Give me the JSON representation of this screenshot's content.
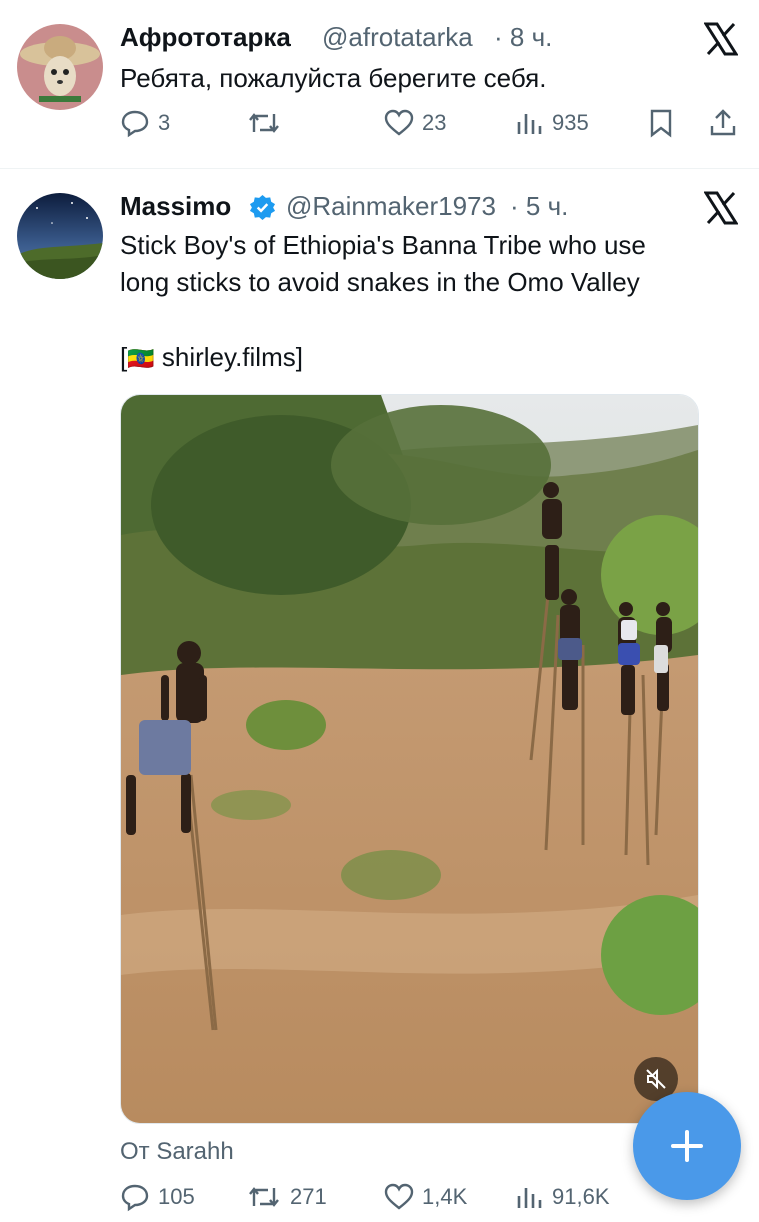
{
  "tweets": [
    {
      "author": "Афрототарка",
      "handle": "@afrotatarka",
      "time": "· 8 ч.",
      "text": "Ребята, пожалуйста берегите себя.",
      "stats": {
        "replies": "3",
        "retweets": "",
        "likes": "23",
        "views": "935"
      }
    },
    {
      "author": "Massimo",
      "handle": "@Rainmaker1973",
      "time": "· 5 ч.",
      "text_line1": "Stick Boy's of Ethiopia's Banna Tribe who use",
      "text_line2": "long sticks to avoid snakes in the Omo Valley",
      "source_open": "[",
      "source_flag": "🇪🇹",
      "source_name": "shirley.films]",
      "from_label": "От Sarahh",
      "stats": {
        "replies": "105",
        "retweets": "271",
        "likes": "1,4K",
        "views": "91,6K"
      }
    }
  ],
  "colors": {
    "accent": "#1d9bf0",
    "fab": "#4a99e9",
    "secondary_text": "#536471"
  },
  "icons": [
    "x-logo-icon",
    "verified-badge-icon",
    "reply-icon",
    "retweet-icon",
    "like-icon",
    "views-icon",
    "bookmark-icon",
    "share-icon",
    "mute-icon",
    "plus-icon"
  ]
}
